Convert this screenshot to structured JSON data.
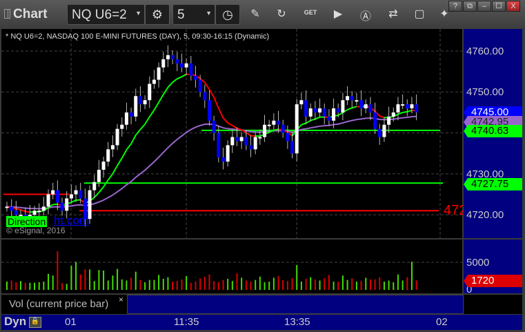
{
  "window": {
    "title": "Chart",
    "buttons": [
      "?",
      "⧉",
      "–",
      "☐",
      "X"
    ]
  },
  "toolbar": {
    "symbol": "NQ U6=2",
    "interval": "5",
    "icons": [
      "gear-icon",
      "clock-icon",
      "pencil-icon",
      "refresh-chart-icon",
      "get-icon",
      "play-icon",
      "alert-icon",
      "link-icon",
      "comment-icon",
      "twitter-icon"
    ]
  },
  "chart": {
    "info": "* NQ U6=2, NASDAQ 100 E-MINI FUTURES (DAY), 5, 09:30-16:15 (Dynamic)",
    "watermark_green": "Direction",
    "watermark_blue": "ht.com",
    "copyright": "© eSignal, 2016",
    "overflow_label": "472",
    "price_labels": [
      "4760.00",
      "4750.00",
      "4730.00",
      "4720.00"
    ],
    "tags": [
      {
        "text": "4745.00",
        "bg": "#0000ff",
        "fg": "#ffffff"
      },
      {
        "text": "4742.95",
        "bg": "#9966cc",
        "fg": "#222222"
      },
      {
        "text": "4740.63",
        "bg": "#00ff00",
        "fg": "#000000"
      },
      {
        "text": "4727.75",
        "bg": "#00ff00",
        "fg": "#000000"
      }
    ],
    "volume_labels": [
      "5000",
      "0"
    ],
    "volume_tag": "1720",
    "volume_title": "Vol (current price bar)",
    "close_mark": "×",
    "time_labels": [
      "01",
      "11:35",
      "13:35",
      "02"
    ],
    "dyn": "Dyn"
  },
  "colors": {
    "up": "#ffffff",
    "down": "#0000ff",
    "ma_fast": "#00ff00",
    "ma_down": "#ff0000",
    "ma_slow": "#9966cc",
    "axis_bg": "#000080"
  },
  "chart_data": {
    "type": "candlestick",
    "ylim": [
      4716,
      4764
    ],
    "levels": [
      {
        "price": 4721,
        "color": "#ff0000"
      },
      {
        "price": 4727.75,
        "color": "#00ff00"
      },
      {
        "price": 4740.63,
        "color": "#00ff00"
      }
    ],
    "closes": [
      4722,
      4721,
      4720,
      4720,
      4719,
      4720,
      4721,
      4721,
      4722,
      4725,
      4726,
      4723,
      4721,
      4724,
      4725,
      4726,
      4724,
      4719,
      4726,
      4728,
      4731,
      4733,
      4736,
      4737,
      4741,
      4742,
      4745,
      4744,
      4749,
      4747,
      4748,
      4752,
      4753,
      4756,
      4758,
      4759,
      4758,
      4757,
      4756,
      4757,
      4754,
      4753,
      4750,
      4748,
      4743,
      4740,
      4734,
      4733,
      4737,
      4739,
      4738,
      4739,
      4737,
      4736,
      4739,
      4739,
      4742,
      4742,
      4743,
      4742,
      4740,
      4738,
      4735,
      4747,
      4748,
      4744,
      4746,
      4745,
      4746,
      4744,
      4743,
      4746,
      4745,
      4748,
      4749,
      4748,
      4748,
      4746,
      4747,
      4745,
      4741,
      4739,
      4742,
      4744,
      4745,
      4747,
      4747,
      4746,
      4747,
      4745
    ],
    "volumes": [
      1500,
      1700,
      1400,
      1600,
      1300,
      1300,
      1300,
      1400,
      1500,
      2900,
      2600,
      7000,
      1200,
      1100,
      4400,
      5100,
      2800,
      3700,
      3700,
      1600,
      3600,
      3500,
      1700,
      2600,
      3800,
      1900,
      1700,
      2200,
      3300,
      1800,
      1400,
      1800,
      1800,
      2700,
      2000,
      2300,
      1500,
      1600,
      1900,
      2500,
      1300,
      1500,
      2100,
      2400,
      2800,
      1600,
      1400,
      1800,
      2000,
      1600,
      3000,
      2200,
      1700,
      1500,
      1800,
      2400,
      1400,
      1500,
      2200,
      2500,
      1800,
      1600,
      2100,
      4500,
      1500,
      2000,
      2300,
      1900,
      1700,
      2100,
      2700,
      1500,
      1500,
      2600,
      1800,
      2100,
      1500,
      1600,
      2200,
      1900,
      1900,
      2300,
      1500,
      1700,
      1400,
      2800,
      1700,
      2300,
      5100,
      1720
    ]
  }
}
